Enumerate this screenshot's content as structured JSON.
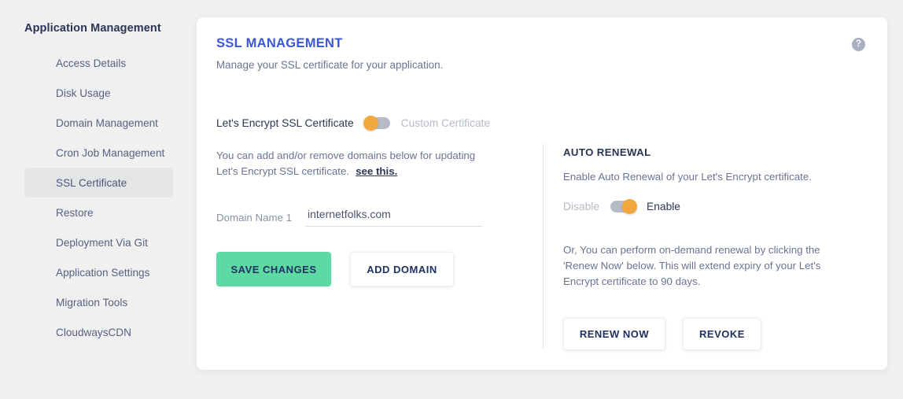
{
  "sidebar": {
    "title": "Application Management",
    "items": [
      {
        "label": "Access Details",
        "active": false
      },
      {
        "label": "Disk Usage",
        "active": false
      },
      {
        "label": "Domain Management",
        "active": false
      },
      {
        "label": "Cron Job Management",
        "active": false
      },
      {
        "label": "SSL Certificate",
        "active": true
      },
      {
        "label": "Restore",
        "active": false
      },
      {
        "label": "Deployment Via Git",
        "active": false
      },
      {
        "label": "Application Settings",
        "active": false
      },
      {
        "label": "Migration Tools",
        "active": false
      },
      {
        "label": "CloudwaysCDN",
        "active": false
      }
    ]
  },
  "card": {
    "title": "SSL MANAGEMENT",
    "subtitle": "Manage your SSL certificate for your application.",
    "help_icon": "help-question-icon",
    "help_glyph": "?"
  },
  "cert_toggle": {
    "left_label": "Let's Encrypt SSL Certificate",
    "right_label": "Custom Certificate",
    "selected": "left",
    "knob_color": "#f0a83f",
    "track_color": "#b6bbc7"
  },
  "left_column": {
    "info_text": "You can add and/or remove domains below for updating Let's Encrypt SSL certificate.",
    "link_text": "see this.",
    "domain_label": "Domain Name 1",
    "domain_value": "internetfolks.com",
    "domain_placeholder": "Enter domain name",
    "save_button": "SAVE CHANGES",
    "add_button": "ADD DOMAIN",
    "save_button_color": "#5ed9a4"
  },
  "right_column": {
    "section_title": "AUTO RENEWAL",
    "section_subtitle": "Enable Auto Renewal of your Let's Encrypt certificate.",
    "toggle_off_label": "Disable",
    "toggle_on_label": "Enable",
    "toggle_selected": "right",
    "renew_text": "Or, You can perform on-demand renewal by clicking the 'Renew Now' below. This will extend expiry of your Let's Encrypt certificate to 90 days.",
    "renew_button": "RENEW NOW",
    "revoke_button": "REVOKE"
  },
  "theme": {
    "page_bg": "#f0f0f1",
    "card_bg": "#ffffff",
    "accent_blue": "#3a57d8",
    "text_dark": "#2b3553",
    "text_muted": "#6c7391",
    "text_disabled": "#b5bac6",
    "active_nav_bg": "#e4e5e7"
  }
}
